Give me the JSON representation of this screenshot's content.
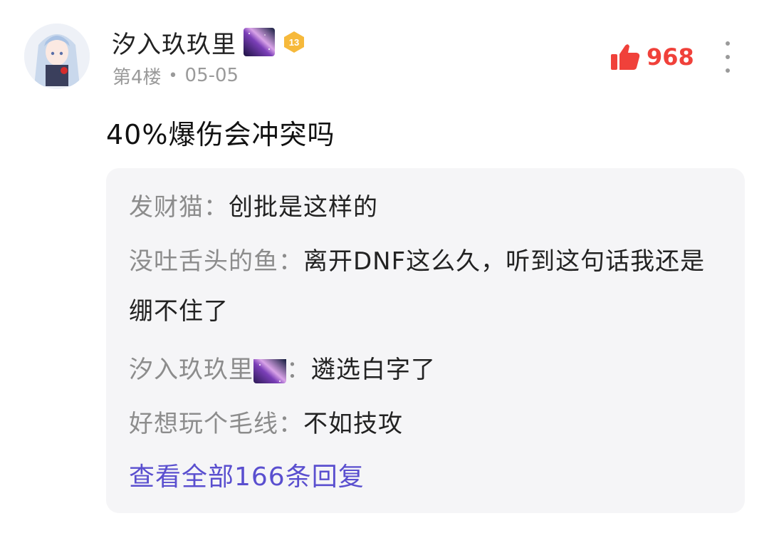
{
  "post": {
    "username": "汐入玖玖里",
    "floor": "第4楼",
    "date": "05-05",
    "level": "13",
    "likes": "968",
    "content": "40%爆伤会冲突吗"
  },
  "replies": [
    {
      "author": "发财猫：",
      "text": "创批是这样的"
    },
    {
      "author": "没吐舌头的鱼：",
      "text": "离开DNF这么久，听到这句话我还是绷不住了"
    },
    {
      "author": "汐入玖玖里",
      "sep": "：",
      "text": "遴选白字了"
    },
    {
      "author": "好想玩个毛线：",
      "text": "不如技攻"
    }
  ],
  "view_all": "查看全部166条回复",
  "colors": {
    "like": "#f0413a",
    "link": "#5a4fcf",
    "meta": "#9a9a9a",
    "reply_bg": "#f5f5f7",
    "level_badge": "#f6b93b"
  },
  "icons": {
    "like": "thumbs-up-icon",
    "more": "more-vertical-icon",
    "level": "level-badge-icon",
    "galaxy": "galaxy-badge-icon"
  }
}
